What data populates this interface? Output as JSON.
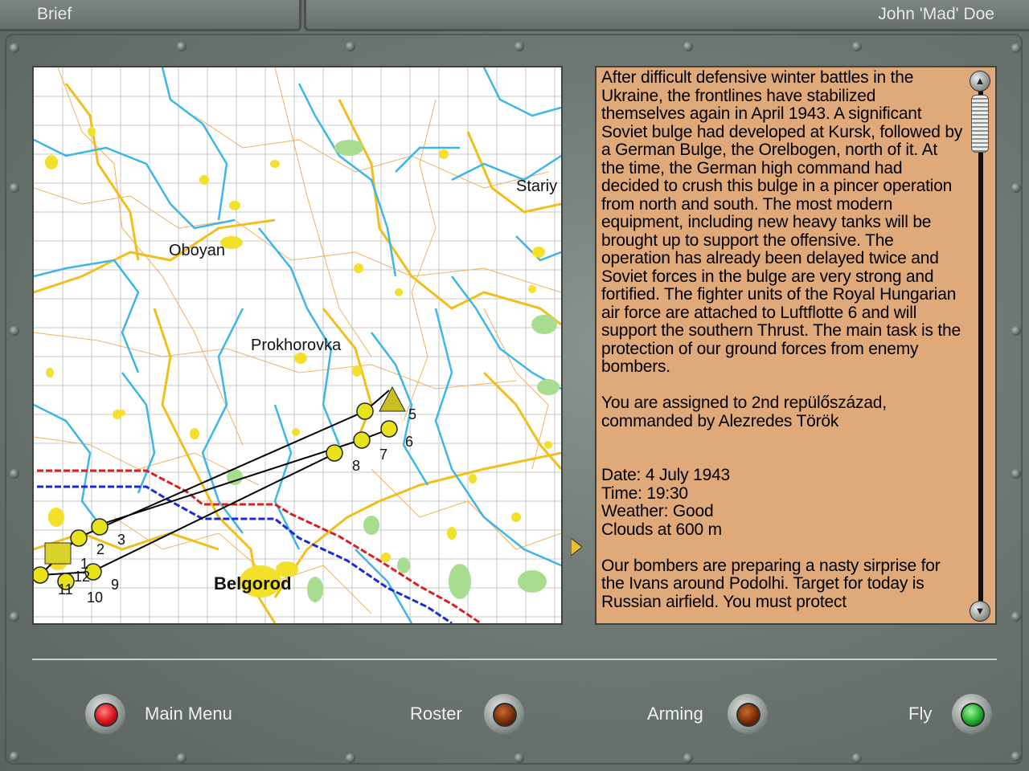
{
  "header": {
    "tab_title": "Brief",
    "pilot_name": "John 'Mad' Doe"
  },
  "map": {
    "places": {
      "oboyan": "Oboyan",
      "prokhorovka": "Prokhorovka",
      "stariy": "Stariy",
      "belgorod": "Belgorod"
    },
    "waypoints": [
      "1",
      "2",
      "3",
      "5",
      "6",
      "7",
      "8",
      "9",
      "10",
      "11",
      "12"
    ]
  },
  "briefing": {
    "text": "After difficult defensive winter battles in the Ukraine, the frontlines have stabilized themselves again in April 1943. A significant Soviet bulge had developed at Kursk, followed by a German Bulge, the Orelbogen, north of it. At the time, the German high command had decided to crush this bulge in a pincer operation from north and south. The most modern equipment, including new heavy tanks will be brought up to support the offensive. The operation has already been delayed twice and Soviet forces in the bulge are very strong and fortified. The fighter units of the Royal Hungarian air force are attached to Luftflotte 6 and will support the southern Thrust. The main task is the protection of our ground forces from enemy bombers.\n\nYou are assigned to 2nd repülőszázad, commanded by Alezredes Török\n\n\nDate: 4 July 1943\nTime: 19:30\nWeather: Good\nClouds at 600 m\n\nOur bombers are preparing a nasty sirprise for the Ivans around Podolhi. Target for today is Russian airfield. You must protect"
  },
  "buttons": {
    "main_menu": "Main Menu",
    "roster": "Roster",
    "arming": "Arming",
    "fly": "Fly"
  },
  "colors": {
    "main_menu_lamp": "#d8141a",
    "roster_lamp": "#7a2e08",
    "arming_lamp": "#7a2e08",
    "fly_lamp": "#1fae2a",
    "brief_bg": "#dfa97a"
  }
}
